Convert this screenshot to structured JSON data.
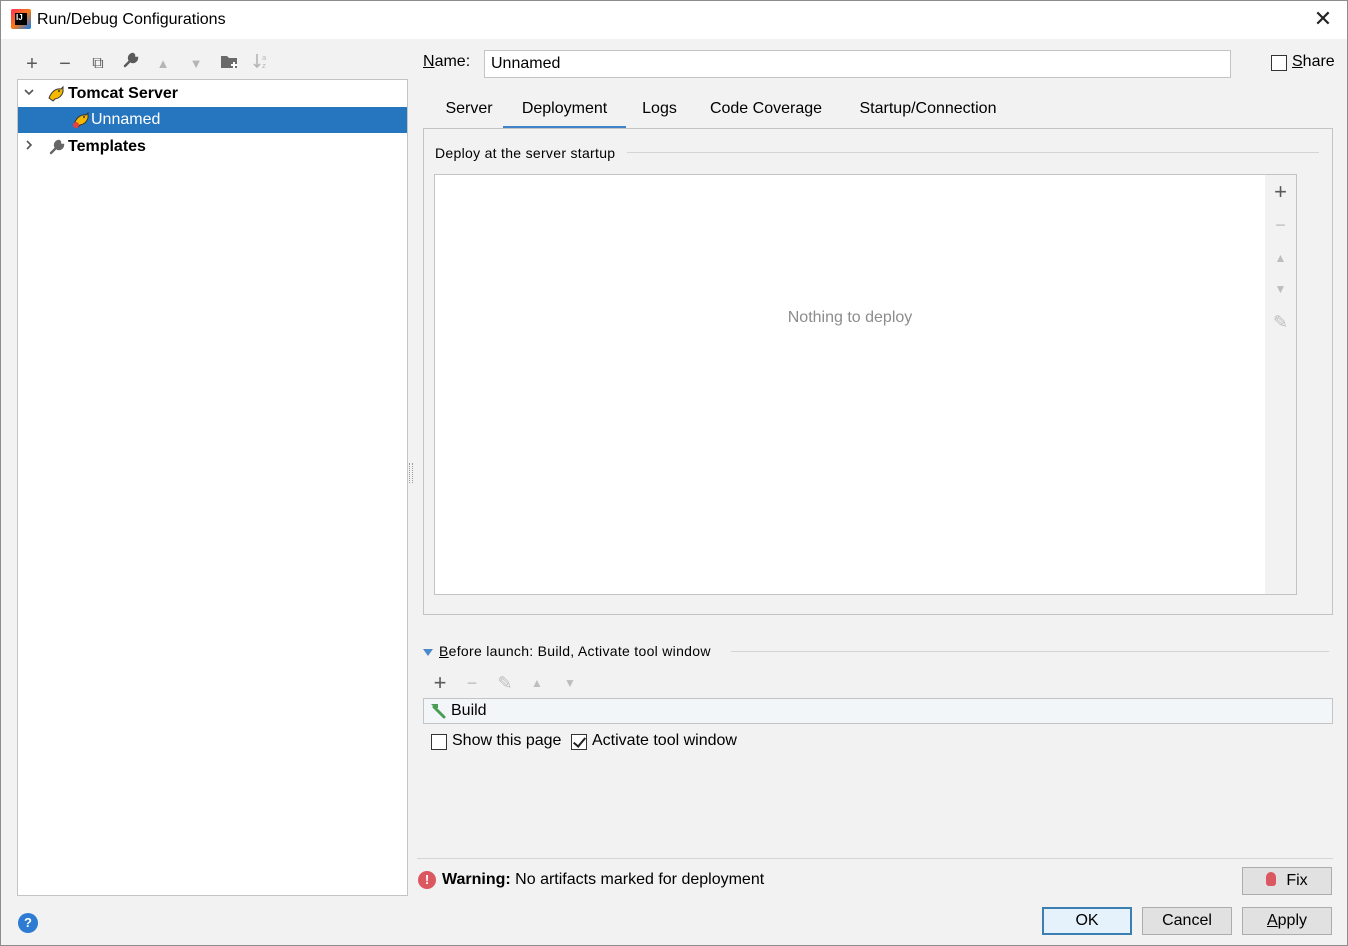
{
  "window": {
    "title": "Run/Debug Configurations",
    "close_symbol": "✕"
  },
  "toolbar": {
    "add": "+",
    "remove": "−",
    "copy": "⧉",
    "edit_defaults": "🔧",
    "move_up": "▲",
    "move_down": "▼",
    "new_folder": "📁",
    "sort": "↓ᵃᶻ"
  },
  "tree": {
    "items": [
      {
        "label": "Tomcat Server",
        "expanded": true
      },
      {
        "label": "Unnamed",
        "selected": true
      },
      {
        "label": "Templates",
        "expanded": false
      }
    ]
  },
  "form": {
    "name_label_prefix": "N",
    "name_label_rest": "ame:",
    "name_value": "Unnamed",
    "share_label_prefix": "S",
    "share_label_rest": "hare",
    "share_checked": false
  },
  "tabs": [
    {
      "label": "Server"
    },
    {
      "label": "Deployment",
      "active": true
    },
    {
      "label": "Logs"
    },
    {
      "label": "Code Coverage"
    },
    {
      "label": "Startup/Connection"
    }
  ],
  "deployment": {
    "section_title": "Deploy at the server startup",
    "empty_text": "Nothing to deploy",
    "side_tools": {
      "add": "+",
      "remove": "−",
      "up": "▲",
      "down": "▼",
      "edit": "✎"
    }
  },
  "before_launch": {
    "title_prefix": "B",
    "title_rest": "efore launch: Build, Activate tool window",
    "tools": {
      "add": "+",
      "remove": "−",
      "edit": "✎",
      "up": "▲",
      "down": "▼"
    },
    "items": [
      {
        "label": "Build"
      }
    ],
    "show_this_page_label": "Show this page",
    "show_this_page_checked": false,
    "activate_tool_window_label": "Activate tool window",
    "activate_tool_window_checked": true
  },
  "warning": {
    "icon": "!",
    "bold": "Warning:",
    "message": " No artifacts marked for deployment",
    "fix_label": "Fix"
  },
  "buttons": {
    "ok": "OK",
    "cancel": "Cancel",
    "apply_prefix": "A",
    "apply_rest": "pply"
  },
  "help": {
    "icon": "?"
  },
  "colors": {
    "selection": "#2675bf",
    "tab_underline": "#4083c9",
    "warning": "#db5860",
    "help": "#2d7bd3"
  }
}
